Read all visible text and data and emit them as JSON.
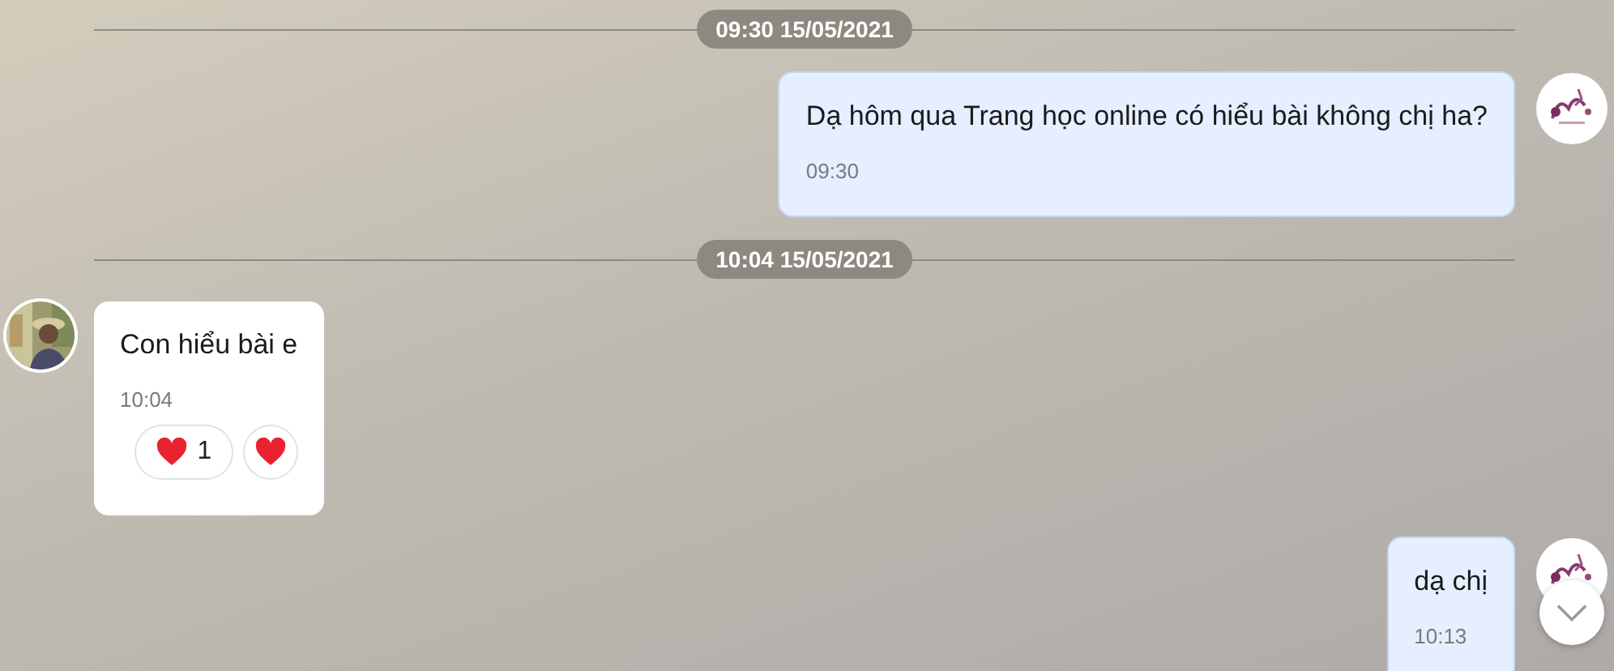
{
  "messages": [
    {
      "kind": "divider",
      "label": "09:30 15/05/2021"
    },
    {
      "kind": "message",
      "outgoing": true,
      "text": "Dạ hôm qua Trang học online có hiểu bài không chị ha?",
      "time": "09:30"
    },
    {
      "kind": "divider",
      "label": "10:04 15/05/2021"
    },
    {
      "kind": "message",
      "outgoing": false,
      "text": "Con hiểu bài e",
      "time": "10:04",
      "reactions": [
        {
          "count": "1"
        }
      ]
    },
    {
      "kind": "message",
      "outgoing": true,
      "text": "dạ chị",
      "time": "10:13"
    }
  ]
}
